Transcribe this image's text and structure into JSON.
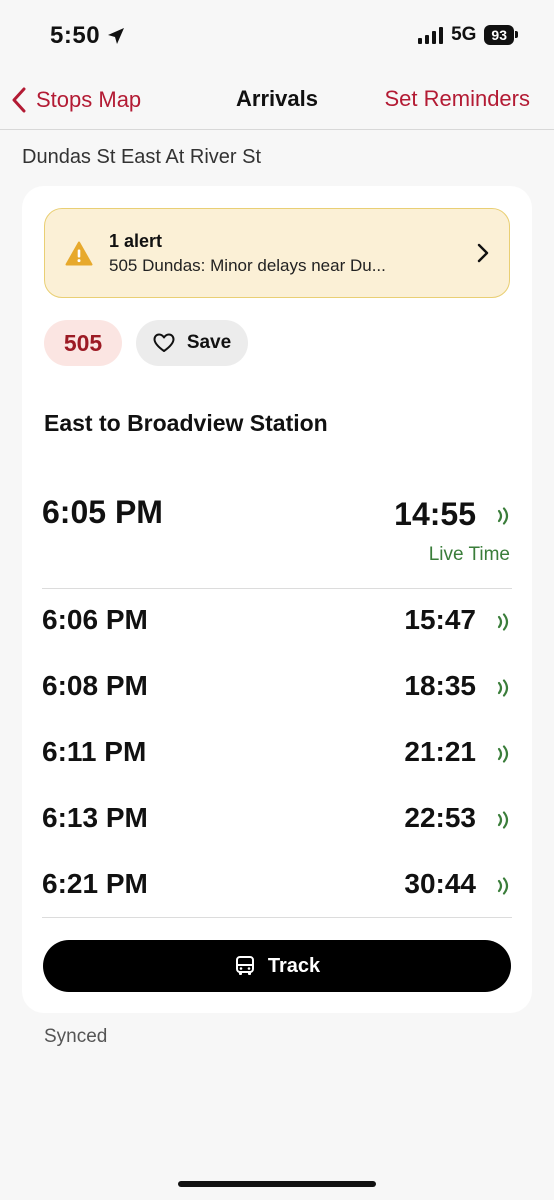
{
  "status_bar": {
    "time": "5:50",
    "network": "5G",
    "battery": "93"
  },
  "nav": {
    "back_label": "Stops Map",
    "title": "Arrivals",
    "action_label": "Set Reminders"
  },
  "stop": {
    "name": "Dundas St East At River St"
  },
  "alert": {
    "title": "1 alert",
    "text": "505 Dundas: Minor delays near Du..."
  },
  "route": {
    "number": "505",
    "save_label": "Save"
  },
  "direction": "East to Broadview Station",
  "arrivals": [
    {
      "scheduled": "6:05 PM",
      "countdown": "14:55"
    },
    {
      "scheduled": "6:06 PM",
      "countdown": "15:47"
    },
    {
      "scheduled": "6:08 PM",
      "countdown": "18:35"
    },
    {
      "scheduled": "6:11 PM",
      "countdown": "21:21"
    },
    {
      "scheduled": "6:13 PM",
      "countdown": "22:53"
    },
    {
      "scheduled": "6:21 PM",
      "countdown": "30:44"
    }
  ],
  "live_label": "Live Time",
  "track_label": "Track",
  "sync_status": "Synced",
  "colors": {
    "accent": "#b31b34",
    "live": "#3a7d3a",
    "alert_bg": "#fbf0d6",
    "route_bg": "#fbe5e2"
  }
}
